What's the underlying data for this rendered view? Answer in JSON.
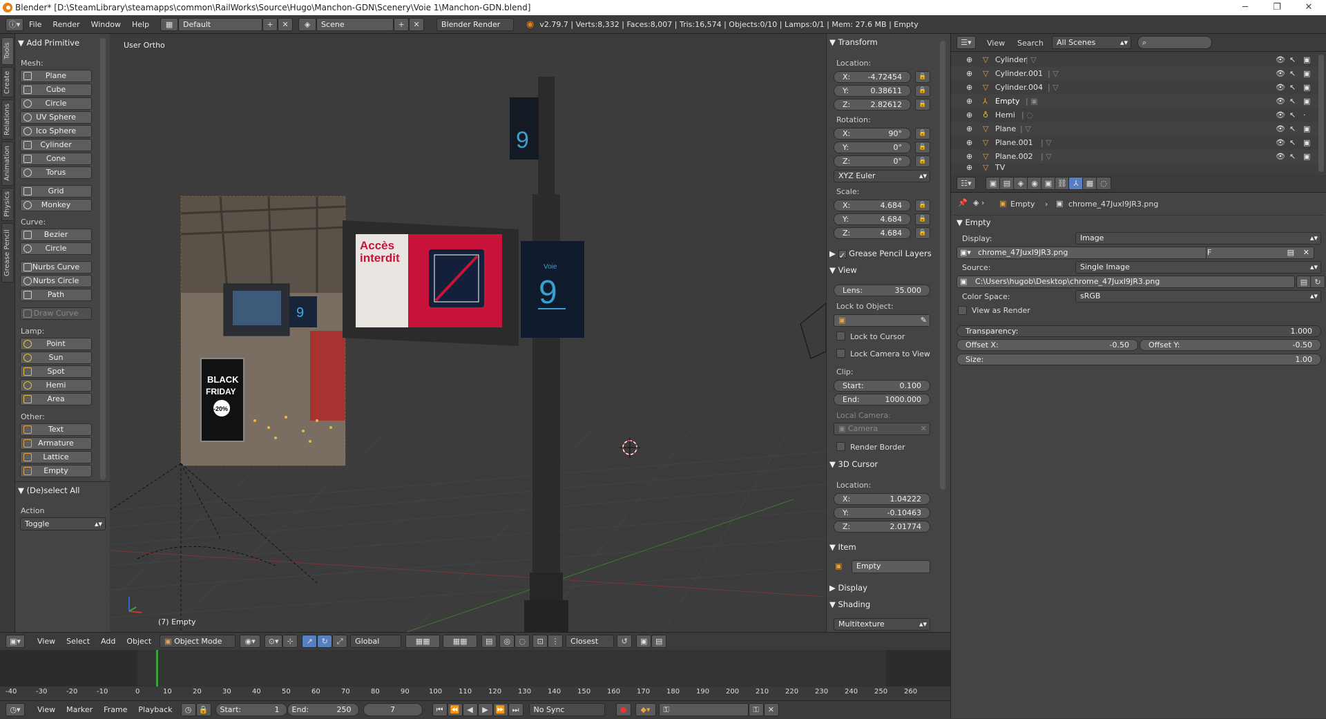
{
  "window": {
    "title": "Blender* [D:\\SteamLibrary\\steamapps\\common\\RailWorks\\Source\\Hugo\\Manchon-GDN\\Scenery\\Voie 1\\Manchon-GDN.blend]"
  },
  "info_header": {
    "menus": [
      "File",
      "Render",
      "Window",
      "Help"
    ],
    "layout": "Default",
    "scene": "Scene",
    "engine": "Blender Render",
    "stats": "v2.79.7 | Verts:8,332 | Faces:8,007 | Tris:16,574 | Objects:0/10 | Lamps:0/1 | Mem: 27.6 MB | Empty"
  },
  "tool_tabs": [
    "Tools",
    "Create",
    "Relations",
    "Animation",
    "Physics",
    "Grease Pencil"
  ],
  "tool_shelf": {
    "title": "Add Primitive",
    "mesh_label": "Mesh:",
    "mesh": [
      "Plane",
      "Cube",
      "Circle",
      "UV Sphere",
      "Ico Sphere",
      "Cylinder",
      "Cone",
      "Torus"
    ],
    "mesh2": [
      "Grid",
      "Monkey"
    ],
    "curve_label": "Curve:",
    "curve": [
      "Bezier",
      "Circle"
    ],
    "curve2": [
      "Nurbs Curve",
      "Nurbs Circle",
      "Path"
    ],
    "draw_curve": "Draw Curve",
    "lamp_label": "Lamp:",
    "lamp": [
      "Point",
      "Sun",
      "Spot",
      "Hemi",
      "Area"
    ],
    "other_label": "Other:",
    "other": [
      "Text",
      "Armature",
      "Lattice",
      "Empty"
    ],
    "deselect_title": "(De)select All",
    "action_label": "Action",
    "action_value": "Toggle"
  },
  "viewport": {
    "view_name": "User Ortho",
    "object_label": "(7) Empty",
    "sign_text_1": "Accès",
    "sign_text_2": "interdit",
    "voie_label": "Voie",
    "voie_number": "9",
    "photo_black": "BLACK",
    "photo_friday": "FRIDAY",
    "photo_percent": "-20%"
  },
  "viewport_header": {
    "menus": [
      "View",
      "Select",
      "Add",
      "Object"
    ],
    "mode": "Object Mode",
    "orientation": "Global",
    "snap": "Closest"
  },
  "npanel": {
    "transform": "Transform",
    "location": "Location:",
    "loc": [
      {
        "k": "X:",
        "v": "-4.72454"
      },
      {
        "k": "Y:",
        "v": "0.38611"
      },
      {
        "k": "Z:",
        "v": "2.82612"
      }
    ],
    "rotation": "Rotation:",
    "rot": [
      {
        "k": "X:",
        "v": "90°"
      },
      {
        "k": "Y:",
        "v": "0°"
      },
      {
        "k": "Z:",
        "v": "0°"
      }
    ],
    "rot_mode": "XYZ Euler",
    "scale": "Scale:",
    "scl": [
      {
        "k": "X:",
        "v": "4.684"
      },
      {
        "k": "Y:",
        "v": "4.684"
      },
      {
        "k": "Z:",
        "v": "4.684"
      }
    ],
    "grease": "Grease Pencil Layers",
    "view": "View",
    "lens_k": "Lens:",
    "lens_v": "35.000",
    "lock_obj": "Lock to Object:",
    "lock_cursor": "Lock to Cursor",
    "lock_cam": "Lock Camera to View",
    "clip": "Clip:",
    "clip_start_k": "Start:",
    "clip_start_v": "0.100",
    "clip_end_k": "End:",
    "clip_end_v": "1000.000",
    "local_cam": "Local Camera:",
    "camera": "Camera",
    "render_border": "Render Border",
    "cursor": "3D Cursor",
    "cursor_loc": "Location:",
    "cur": [
      {
        "k": "X:",
        "v": "1.04222"
      },
      {
        "k": "Y:",
        "v": "-0.10463"
      },
      {
        "k": "Z:",
        "v": "2.01774"
      }
    ],
    "item": "Item",
    "item_name": "Empty",
    "display": "Display",
    "shading": "Shading",
    "shading_value": "Multitexture"
  },
  "outliner": {
    "view": "View",
    "search": "Search",
    "filter": "All Scenes",
    "rows": [
      "Cylinder",
      "Cylinder.001",
      "Cylinder.004",
      "Empty",
      "Hemi",
      "Plane",
      "Plane.001",
      "Plane.002",
      "TV"
    ]
  },
  "properties": {
    "crumb_obj": "Empty",
    "crumb_img": "chrome_47JuxI9JR3.png",
    "panel": "Empty",
    "display_k": "Display:",
    "display_v": "Image",
    "image_name": "chrome_47JuxI9JR3.png",
    "image_f": "F",
    "source_k": "Source:",
    "source_v": "Single Image",
    "path": "C:\\Users\\hugob\\Desktop\\chrome_47JuxI9JR3.png",
    "colorspace_k": "Color Space:",
    "colorspace_v": "sRGB",
    "view_as_render": "View as Render",
    "transparency_k": "Transparency:",
    "transparency_v": "1.000",
    "offx_k": "Offset X:",
    "offx_v": "-0.50",
    "offy_k": "Offset Y:",
    "offy_v": "-0.50",
    "size_k": "Size:",
    "size_v": "1.00"
  },
  "timeline": {
    "ticks": [
      "-40",
      "-30",
      "-20",
      "-10",
      "0",
      "10",
      "20",
      "30",
      "40",
      "50",
      "60",
      "70",
      "80",
      "90",
      "100",
      "110",
      "120",
      "130",
      "140",
      "150",
      "160",
      "170",
      "180",
      "190",
      "200",
      "210",
      "220",
      "230",
      "240",
      "250",
      "260"
    ],
    "menus": [
      "View",
      "Marker",
      "Frame",
      "Playback"
    ],
    "start_k": "Start:",
    "start_v": "1",
    "end_k": "End:",
    "end_v": "250",
    "current": "7",
    "sync": "No Sync"
  }
}
